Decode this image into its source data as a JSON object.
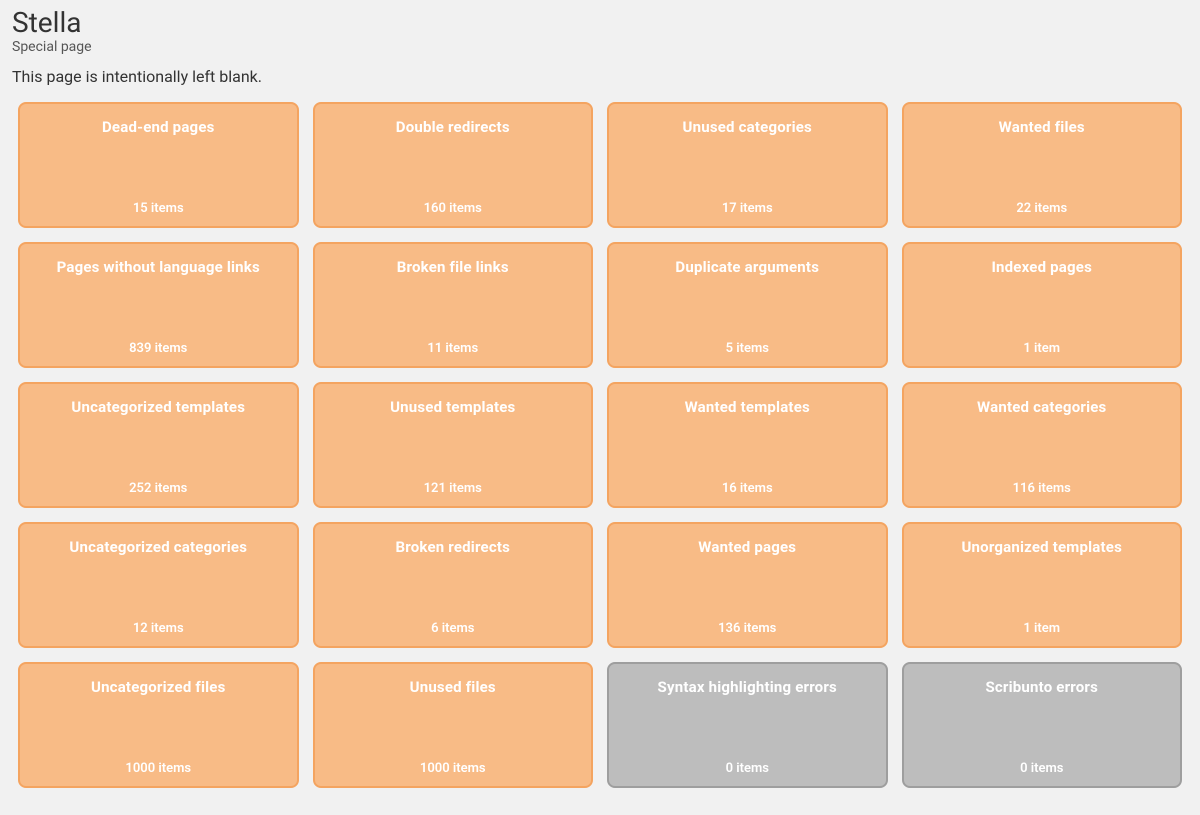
{
  "header": {
    "title": "Stella",
    "subtitle": "Special page",
    "description": "This page is intentionally left blank."
  },
  "cards": [
    {
      "title": "Dead-end pages",
      "count": "15 items",
      "variant": "orange"
    },
    {
      "title": "Double redirects",
      "count": "160 items",
      "variant": "orange"
    },
    {
      "title": "Unused categories",
      "count": "17 items",
      "variant": "orange"
    },
    {
      "title": "Wanted files",
      "count": "22 items",
      "variant": "orange"
    },
    {
      "title": "Pages without language links",
      "count": "839 items",
      "variant": "orange"
    },
    {
      "title": "Broken file links",
      "count": "11 items",
      "variant": "orange"
    },
    {
      "title": "Duplicate arguments",
      "count": "5 items",
      "variant": "orange"
    },
    {
      "title": "Indexed pages",
      "count": "1 item",
      "variant": "orange"
    },
    {
      "title": "Uncategorized templates",
      "count": "252 items",
      "variant": "orange"
    },
    {
      "title": "Unused templates",
      "count": "121 items",
      "variant": "orange"
    },
    {
      "title": "Wanted templates",
      "count": "16 items",
      "variant": "orange"
    },
    {
      "title": "Wanted categories",
      "count": "116 items",
      "variant": "orange"
    },
    {
      "title": "Uncategorized categories",
      "count": "12 items",
      "variant": "orange"
    },
    {
      "title": "Broken redirects",
      "count": "6 items",
      "variant": "orange"
    },
    {
      "title": "Wanted pages",
      "count": "136 items",
      "variant": "orange"
    },
    {
      "title": "Unorganized templates",
      "count": "1 item",
      "variant": "orange"
    },
    {
      "title": "Uncategorized files",
      "count": "1000 items",
      "variant": "orange"
    },
    {
      "title": "Unused files",
      "count": "1000 items",
      "variant": "orange"
    },
    {
      "title": "Syntax highlighting errors",
      "count": "0 items",
      "variant": "grey"
    },
    {
      "title": "Scribunto errors",
      "count": "0 items",
      "variant": "grey"
    }
  ]
}
